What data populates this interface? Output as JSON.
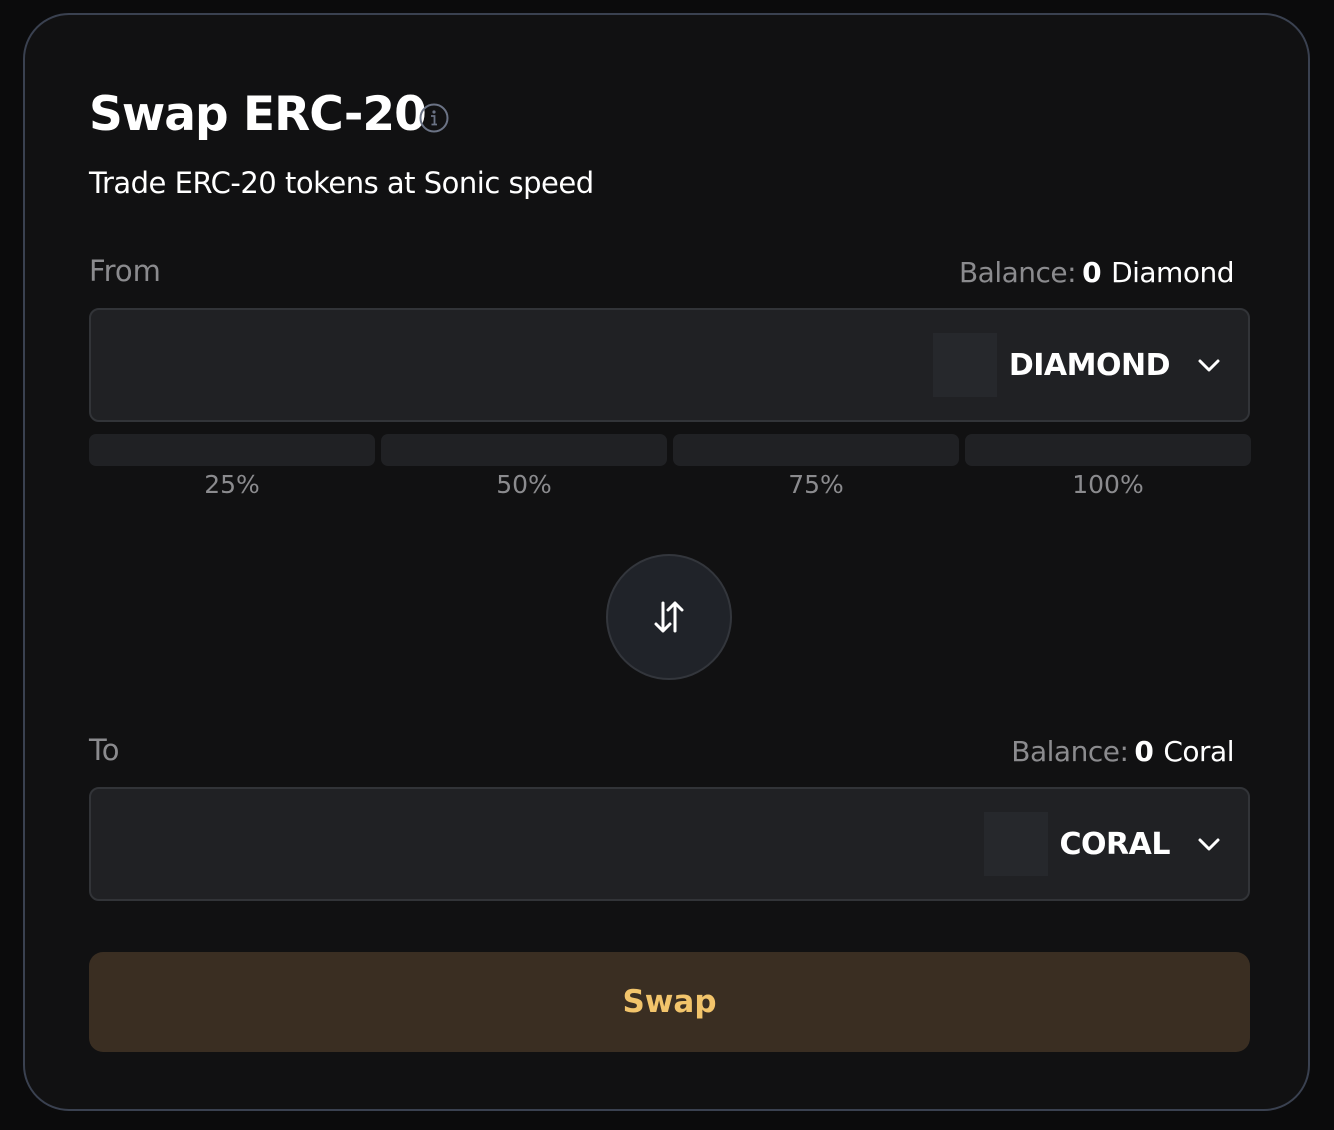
{
  "header": {
    "title": "Swap ERC-20",
    "info_icon": "info-icon",
    "subtitle": "Trade ERC-20 tokens at Sonic speed"
  },
  "from": {
    "label": "From",
    "balance_label": "Balance:",
    "balance_amount": "0",
    "balance_token": "Diamond",
    "amount_value": "",
    "amount_placeholder": "",
    "token_symbol": "DIAMOND",
    "chevron_icon": "chevron-down-icon"
  },
  "percent_options": [
    "25%",
    "50%",
    "75%",
    "100%"
  ],
  "switch_icon": "swap-vertical-arrows-icon",
  "to": {
    "label": "To",
    "balance_label": "Balance:",
    "balance_amount": "0",
    "balance_token": "Coral",
    "amount_value": "",
    "amount_placeholder": "",
    "token_symbol": "CORAL",
    "chevron_icon": "chevron-down-icon"
  },
  "swap_button_label": "Swap",
  "colors": {
    "background": "#111112",
    "card_border": "#3a4150",
    "field_bg": "#202124",
    "muted_text": "#8b8b8e",
    "accent": "#f2c46b",
    "swap_button_bg": "#3a2e22"
  }
}
